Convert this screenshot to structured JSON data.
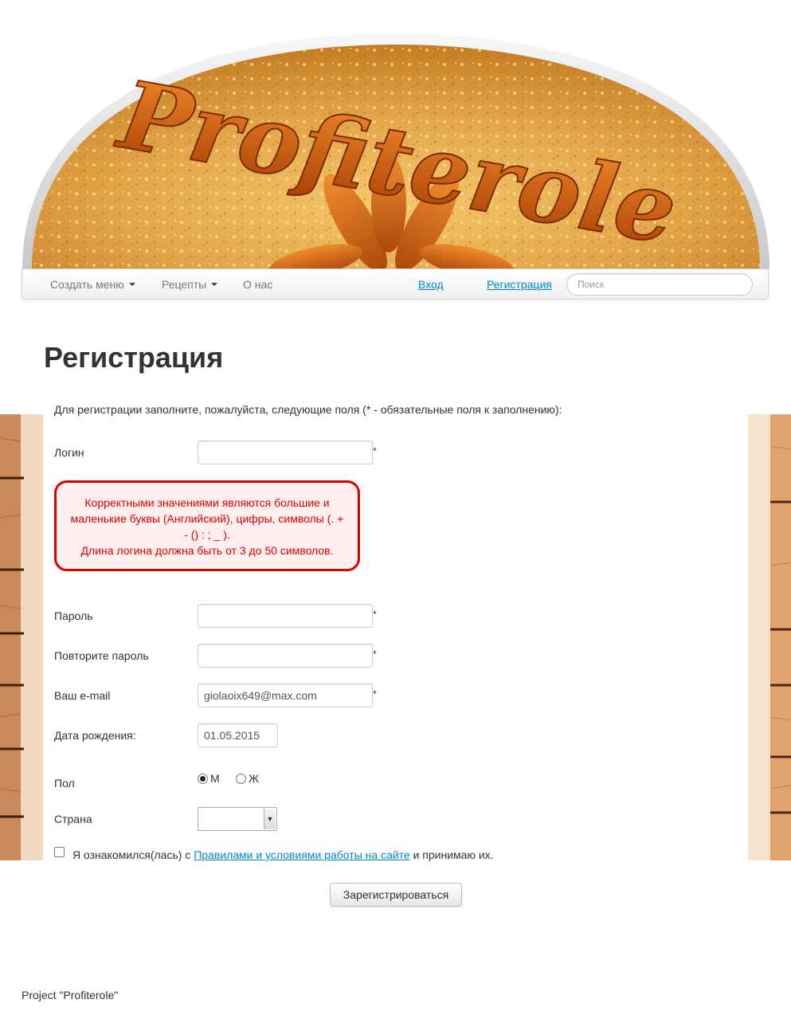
{
  "header": {
    "logo_text": "Profiterole"
  },
  "nav": {
    "menu_create": "Создать меню",
    "menu_recipes": "Рецепты",
    "about": "О нас",
    "login": "Вход",
    "register": "Регистрация",
    "search_placeholder": "Поиск"
  },
  "page": {
    "title": "Регистрация",
    "intro": "Для регистрации заполните, пожалуйста, следующие поля (* - обязательные поля к заполнению):"
  },
  "form": {
    "login": {
      "label": "Логин",
      "value": "",
      "required_mark": "*"
    },
    "error": {
      "line1": "Корректными значениями являются большие и маленькие буквы (Английский), цифры, символы (. + - () : ; _ ).",
      "line2": "Длина логина должна быть от 3 до 50 символов."
    },
    "password": {
      "label": "Пароль",
      "value": "",
      "required_mark": "*"
    },
    "password_repeat": {
      "label": "Повторите пароль",
      "value": "",
      "required_mark": "*"
    },
    "email": {
      "label": "Ваш e-mail",
      "value": "giolaoix649@max.com",
      "required_mark": "*"
    },
    "birthdate": {
      "label": "Дата рождения:",
      "value": "01.05.2015"
    },
    "gender": {
      "label": "Пол",
      "option_m": "М",
      "option_f": "Ж",
      "selected": "М"
    },
    "country": {
      "label": "Страна",
      "selected": ""
    },
    "terms": {
      "before": "Я ознакомился(лась) с ",
      "link": "Правилами и условиями работы на сайте",
      "after": " и принимаю их.",
      "checked": false
    },
    "submit_label": "Зарегистрироваться"
  },
  "footer": {
    "text": "Project \"Profiterole\""
  },
  "colors": {
    "link": "#0088cc",
    "error": "#e10000",
    "error_bg": "#ffeeee",
    "banner_gold": "#e8a640",
    "logo_caramel": "#c8570f"
  }
}
